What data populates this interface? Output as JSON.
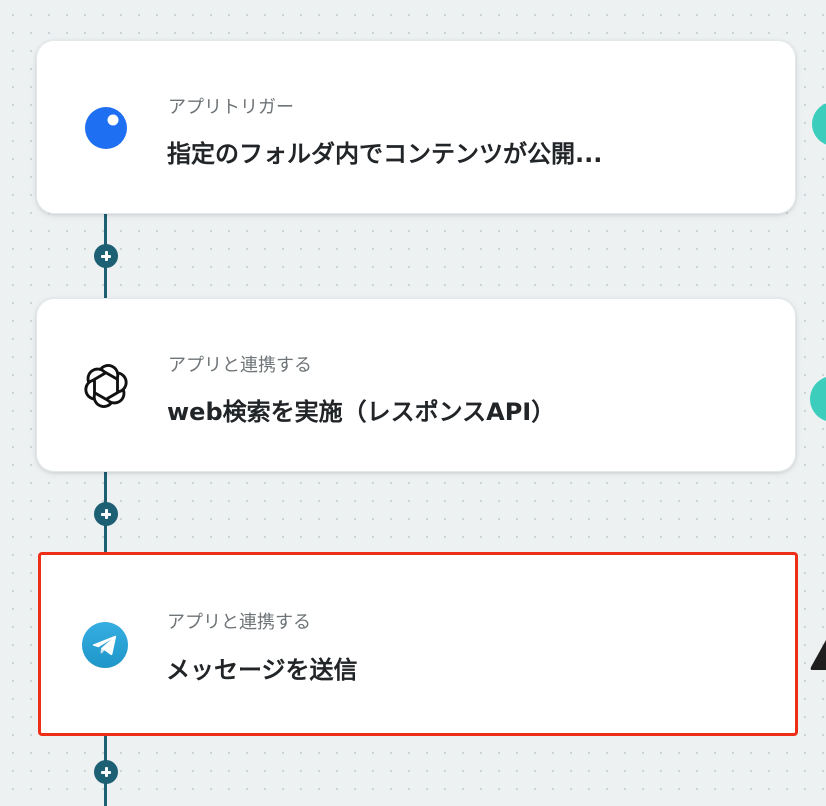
{
  "flow": {
    "steps": [
      {
        "category": "アプリトリガー",
        "title": "指定のフォルダ内でコンテンツが公開...",
        "icon": "blue-dot-app-icon",
        "color": "#1f6ff2"
      },
      {
        "category": "アプリと連携する",
        "title": "web検索を実施（レスポンスAPI）",
        "icon": "openai-knot-icon",
        "color": "#000000"
      },
      {
        "category": "アプリと連携する",
        "title": "メッセージを送信",
        "icon": "telegram-paper-plane-icon",
        "color": "#2aa3de"
      }
    ]
  },
  "colors": {
    "connector": "#1d5f73",
    "selection_border": "#ee2e16",
    "edge_accent": "#3dcdbd"
  }
}
